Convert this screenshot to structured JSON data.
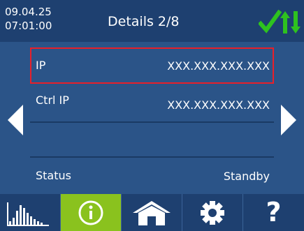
{
  "header": {
    "date": "09.04.25",
    "time": "07:01:00",
    "title": "Details 2/8",
    "icons": [
      "checkmark-icon",
      "up-down-arrows-icon"
    ],
    "colors": {
      "check": "#2ec21f",
      "arrows": "#2ec21f"
    }
  },
  "nav": {
    "prev_icon": "arrow-left-icon",
    "next_icon": "arrow-right-icon"
  },
  "rows": [
    {
      "label": "IP",
      "value": "XXX.XXX.XXX.XXX",
      "selected": true
    },
    {
      "label": "Ctrl IP",
      "value": "XXX.XXX.XXX.XXX",
      "selected": false
    },
    {
      "label": "",
      "value": "",
      "selected": false
    },
    {
      "label": "Status",
      "value": "Standby",
      "selected": false
    }
  ],
  "tabs": [
    {
      "icon": "bar-chart-icon",
      "active": false
    },
    {
      "icon": "info-icon",
      "active": true
    },
    {
      "icon": "home-icon",
      "active": false
    },
    {
      "icon": "gear-icon",
      "active": false
    },
    {
      "icon": "help-icon",
      "text": "?",
      "active": false
    }
  ],
  "colors": {
    "background": "#1e4272",
    "panel": "#2b5488",
    "active_tab": "#8ac21e",
    "selection": "#e8202a"
  }
}
